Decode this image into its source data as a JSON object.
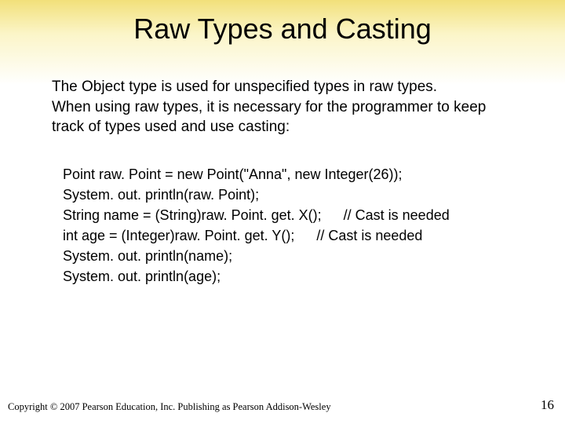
{
  "title": "Raw Types and Casting",
  "paragraph": "The Object type is used for unspecified types in raw types.\nWhen using raw types, it is necessary for the programmer to keep track of types used and use casting:",
  "code": {
    "lines": [
      {
        "left": "Point raw. Point = new Point(\"Anna\", new Integer(26));",
        "right": ""
      },
      {
        "left": "System. out. println(raw. Point);",
        "right": ""
      },
      {
        "left": "String name = (String)raw. Point. get. X();",
        "right": "// Cast is needed"
      },
      {
        "left": "int age = (Integer)raw. Point. get. Y();",
        "right": "// Cast is needed"
      },
      {
        "left": "System. out. println(name);",
        "right": ""
      },
      {
        "left": "System. out. println(age);",
        "right": ""
      }
    ]
  },
  "footer": {
    "copyright": "Copyright © 2007 Pearson Education, Inc. Publishing as Pearson Addison-Wesley",
    "page": "16"
  }
}
